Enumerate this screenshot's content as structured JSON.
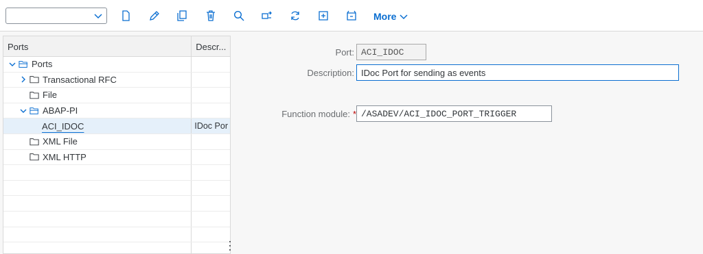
{
  "toolbar": {
    "select_value": "",
    "buttons": [
      "new-icon",
      "edit-icon",
      "copy-icon",
      "delete-icon",
      "search-icon",
      "find-next-icon",
      "refresh-icon",
      "add-icon",
      "clear-icon"
    ],
    "more_label": "More"
  },
  "tree": {
    "columns": [
      "Ports",
      "Descr..."
    ],
    "rows": [
      {
        "label": "Ports",
        "desc": "",
        "level": 0,
        "expander": "expanded",
        "icon": "folder-open-icon"
      },
      {
        "label": "Transactional RFC",
        "desc": "",
        "level": 1,
        "expander": "collapsed",
        "icon": "folder-icon"
      },
      {
        "label": "File",
        "desc": "",
        "level": 1,
        "expander": "none",
        "icon": "folder-icon"
      },
      {
        "label": "ABAP-PI",
        "desc": "",
        "level": 1,
        "expander": "expanded",
        "icon": "folder-open-icon"
      },
      {
        "label": "ACI_IDOC",
        "desc": "IDoc Por",
        "level": 2,
        "expander": "none",
        "icon": "",
        "selected": true
      },
      {
        "label": "XML File",
        "desc": "",
        "level": 1,
        "expander": "none",
        "icon": "folder-icon"
      },
      {
        "label": "XML HTTP",
        "desc": "",
        "level": 1,
        "expander": "none",
        "icon": "folder-icon"
      }
    ]
  },
  "form": {
    "port_label": "Port:",
    "port_value": "ACI_IDOC",
    "description_label": "Description:",
    "description_value": "IDoc Port for sending as events",
    "function_module_label": "Function module:",
    "function_module_required": "*",
    "function_module_value": "/ASADEV/ACI_IDOC_PORT_TRIGGER"
  },
  "colors": {
    "accent": "#0a6ed1",
    "required": "#bb0000",
    "selected_row": "#e5f0fa"
  }
}
